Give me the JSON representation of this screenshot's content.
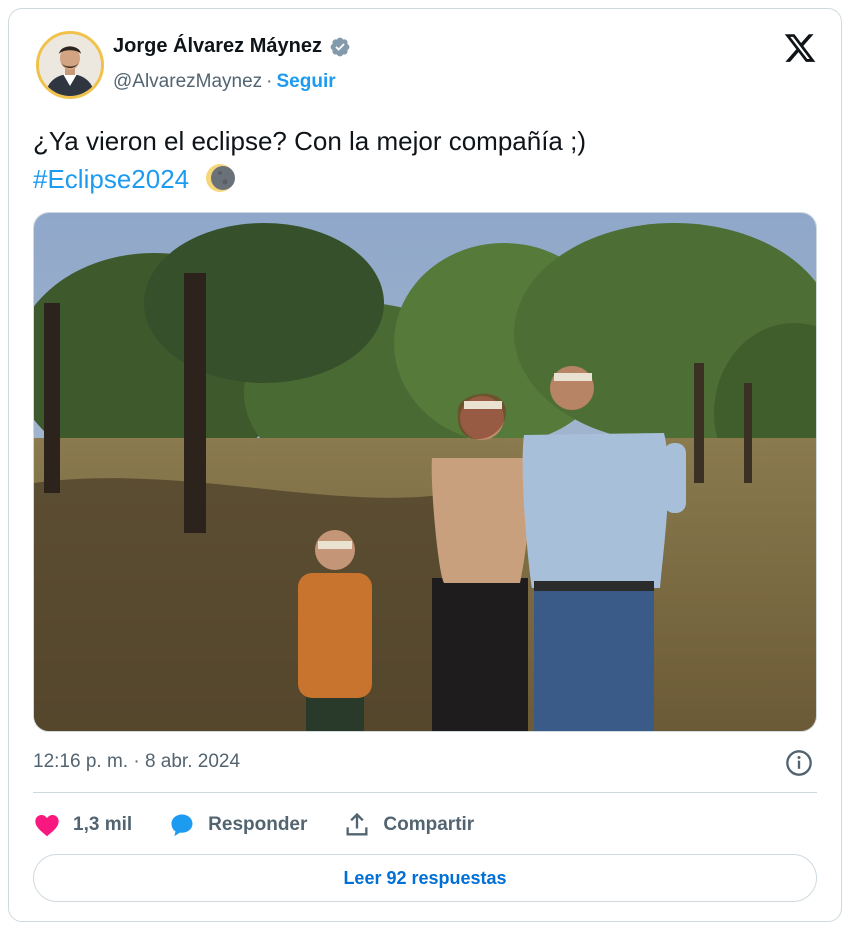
{
  "author": {
    "name": "Jorge Álvarez Máynez",
    "handle": "@AlvarezMaynez",
    "separator": "·",
    "follow_label": "Seguir",
    "verified": true
  },
  "tweet": {
    "text": "¿Ya vieron el eclipse? Con la mejor compañía ;)",
    "hashtag": "#Eclipse2024",
    "emoji": "moon-eclipse-icon",
    "timestamp": "12:16 p. m. · 8 abr. 2024"
  },
  "actions": {
    "likes": "1,3 mil",
    "reply_label": "Responder",
    "share_label": "Compartir",
    "read_replies_label": "Leer 92 respuestas"
  },
  "colors": {
    "accent": "#1d9bf0",
    "like": "#f91880",
    "secondary_text": "#536471",
    "border": "#cfd9de",
    "link_dark": "#006fd6"
  }
}
